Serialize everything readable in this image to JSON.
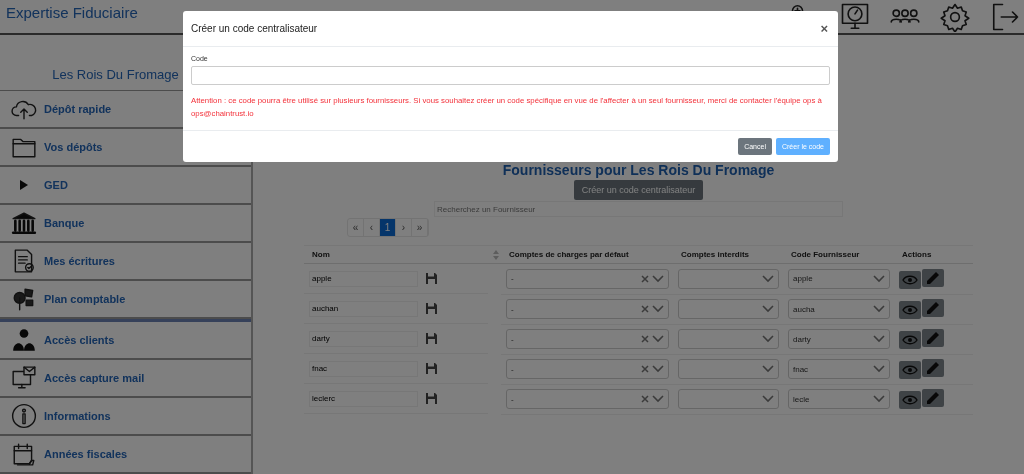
{
  "app": {
    "title": "Expertise Fiduciaire"
  },
  "sidebar": {
    "company": "Les Rois Du Fromage",
    "sections": [
      [
        {
          "kind": "link",
          "label": "Dépôt rapide"
        },
        {
          "kind": "link",
          "label": "Vos dépôts"
        },
        {
          "kind": "group",
          "label": "GED",
          "expanded": false
        },
        {
          "kind": "link",
          "label": "Banque"
        },
        {
          "kind": "link",
          "label": "Mes écritures"
        },
        {
          "kind": "link",
          "label": "Plan comptable"
        }
      ],
      [
        {
          "kind": "link",
          "label": "Accès clients"
        },
        {
          "kind": "link",
          "label": "Accès capture mail"
        },
        {
          "kind": "link",
          "label": "Informations"
        },
        {
          "kind": "link",
          "label": "Années fiscales"
        }
      ]
    ]
  },
  "main": {
    "heading": "Fournisseurs pour Les Rois Du Fromage",
    "create_button": "Créer un code centralisateur",
    "search": {
      "placeholder": "Recherchez un Fournisseur"
    },
    "pagination": [
      {
        "label": "«",
        "disabled": true,
        "selected": false
      },
      {
        "label": "‹",
        "disabled": true,
        "selected": false
      },
      {
        "label": "1",
        "disabled": false,
        "selected": true
      },
      {
        "label": "›",
        "disabled": true,
        "selected": false
      },
      {
        "label": "»",
        "disabled": true,
        "selected": false
      }
    ],
    "table": {
      "columns": [
        {
          "label": "Nom",
          "sortable": true
        },
        {
          "label": "Comptes de charges par défaut",
          "sortable": false
        },
        {
          "label": "Comptes interdits",
          "sortable": false
        },
        {
          "label": "Code Fournisseur",
          "sortable": false
        },
        {
          "label": "Actions",
          "sortable": false
        }
      ],
      "rows": [
        {
          "name": "apple",
          "charges": "-",
          "code": "apple"
        },
        {
          "name": "auchan",
          "charges": "-",
          "code": "aucha"
        },
        {
          "name": "darty",
          "charges": "-",
          "code": "darty"
        },
        {
          "name": "fnac",
          "charges": "-",
          "code": "fnac"
        },
        {
          "name": "leclerc",
          "charges": "-",
          "code": "lecle"
        }
      ]
    }
  },
  "modal": {
    "title": "Créer un code centralisateur",
    "close": "×",
    "field_label": "Code",
    "warning": "Attention : ce code pourra être utilisé sur plusieurs fournisseurs. Si vous souhaitez créer un code spécifique en vue de l'affecter à un seul fournisseur, merci de contacter l'équipe ops à ops@chaintrust.io",
    "buttons": [
      {
        "label": "Cancel",
        "kind": "secondary",
        "disabled": false
      },
      {
        "label": "Créer le code",
        "kind": "primary",
        "disabled": true
      }
    ]
  }
}
